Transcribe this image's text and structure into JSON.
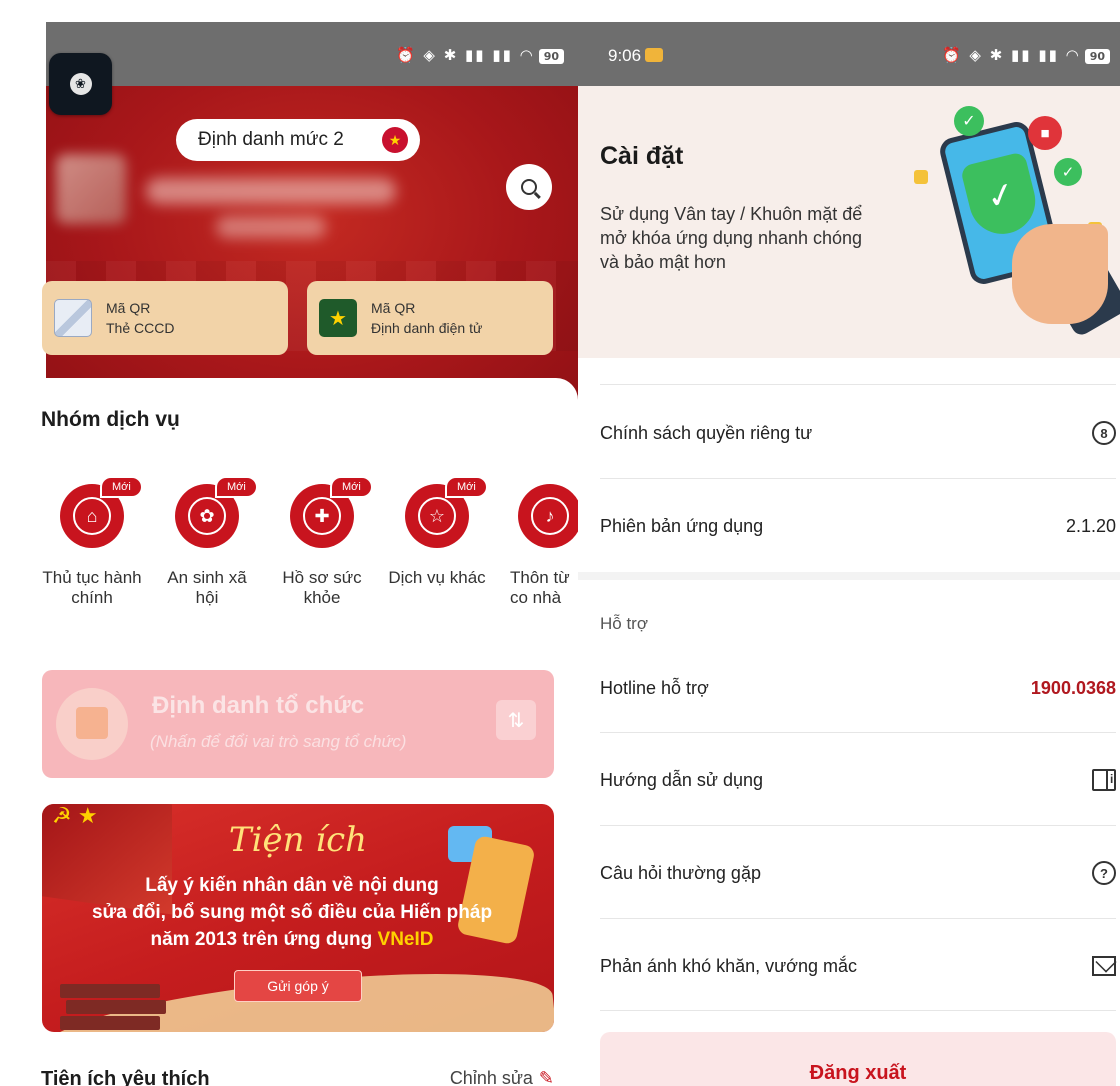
{
  "left": {
    "identity_level": "Định danh mức 2",
    "qr_cards": [
      {
        "title": "Mã QR",
        "subtitle": "Thẻ CCCD"
      },
      {
        "title": "Mã QR",
        "subtitle": "Định danh điện tử"
      }
    ],
    "services_title": "Nhóm dịch vụ",
    "new_badge": "Mới",
    "services": [
      {
        "label": "Thủ tục hành chính",
        "icon": "bank-icon"
      },
      {
        "label": "An sinh xã hội",
        "icon": "family-icon"
      },
      {
        "label": "Hồ sơ sức khỏe",
        "icon": "health-shield-icon"
      },
      {
        "label": "Dịch vụ khác",
        "icon": "star-podium-icon"
      },
      {
        "label": "Thôn từ co nhà",
        "icon": "bell-icon"
      }
    ],
    "org": {
      "title": "Định danh tổ chức",
      "subtitle": "(Nhấn để đổi vai trò sang tổ chức)"
    },
    "promo": {
      "title": "Tiện ích",
      "line1": "Lấy ý kiến nhân dân về nội dung",
      "line2": "sửa đổi, bổ sung một số điều của Hiến pháp",
      "line3": "năm 2013 trên ứng dụng",
      "brand": "VNeID",
      "button": "Gửi góp ý"
    },
    "favorites_title": "Tiện ích yêu thích",
    "favorites_edit": "Chỉnh sửa"
  },
  "right": {
    "time": "9:06",
    "battery": "90",
    "settings_title": "Cài đặt",
    "settings_desc": "Sử dụng Vân tay / Khuôn mặt để mở khóa ứng dụng nhanh chóng và bảo mật hơn",
    "privacy_label": "Chính sách quyền riêng tư",
    "version_label": "Phiên bản ứng dụng",
    "version_value": "2.1.20",
    "support_heading": "Hỗ trợ",
    "hotline_label": "Hotline hỗ trợ",
    "hotline_value": "1900.0368",
    "guide_label": "Hướng dẫn sử dụng",
    "faq_label": "Câu hỏi thường gặp",
    "feedback_label": "Phản ánh khó khăn, vướng mắc",
    "logout_label": "Đăng xuất"
  },
  "colors": {
    "brand_red": "#c8141e",
    "hero_red": "#a8171a",
    "qr_card": "#f2d3a8",
    "hotline": "#b0181f"
  }
}
